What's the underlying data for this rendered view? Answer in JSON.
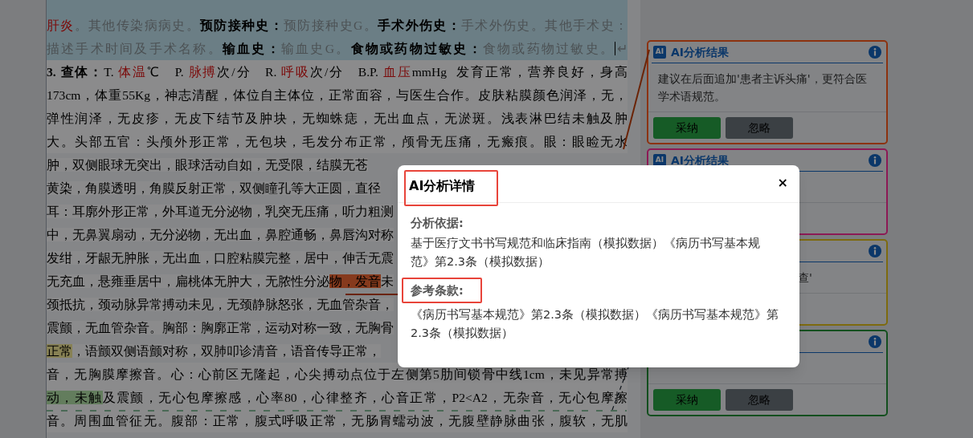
{
  "document": {
    "lines": [
      {
        "kind": "history",
        "segments": [
          {
            "text": "肝炎",
            "kind": "red"
          },
          {
            "text": "。其他传染病病史。",
            "kind": "muted"
          },
          {
            "text": "预防接种史：",
            "kind": "bold"
          },
          {
            "text": "预防接种史G。",
            "kind": "muted"
          },
          {
            "text": "手术外伤史：",
            "kind": "bold"
          },
          {
            "text": "手术外伤史。其他手术史：",
            "kind": "muted"
          }
        ]
      },
      {
        "kind": "history",
        "segments": [
          {
            "text": "描述手术时间及手术名称。",
            "kind": "muted"
          },
          {
            "text": "输血史：",
            "kind": "bold"
          },
          {
            "text": "输血史G。",
            "kind": "muted"
          },
          {
            "text": "食物或药物过敏史：",
            "kind": "bold"
          },
          {
            "text": "食物或药物过敏史。",
            "kind": "muted"
          },
          {
            "text": "↵",
            "kind": "mark"
          }
        ]
      },
      {
        "kind": "exam",
        "segments": [
          {
            "text": "3. 查体：",
            "kind": "bold"
          },
          {
            "text": "T. ",
            "kind": "plain"
          },
          {
            "text": "体温",
            "kind": "red"
          },
          {
            "text": "℃   P. ",
            "kind": "plain"
          },
          {
            "text": "脉搏",
            "kind": "red"
          },
          {
            "text": "次/分   R. ",
            "kind": "plain"
          },
          {
            "text": "呼吸",
            "kind": "red"
          },
          {
            "text": "次/分   B.P. ",
            "kind": "plain"
          },
          {
            "text": "血压",
            "kind": "red"
          },
          {
            "text": "mmHg  发育正常，营养良好，身高",
            "kind": "plain"
          }
        ]
      },
      {
        "kind": "exam",
        "segments": [
          {
            "text": "173cm，体重55Kg，神志清醒，体位自主体位，正常面容，与医生合作。皮肤粘膜颜色润泽，无，",
            "kind": "plain"
          }
        ]
      },
      {
        "kind": "exam",
        "segments": [
          {
            "text": "弹性润泽，无皮疹，无皮下结节及肿块，无蜘蛛痣，无出血点，无淤斑。浅表淋巴结未触及肿",
            "kind": "plain"
          }
        ]
      },
      {
        "kind": "exam",
        "segments": [
          {
            "text": "大。头部五官：头颅外形正常，无包块，毛发分布正常，颅骨无压痛，无瘢痕。眼：眼睑无水",
            "kind": "plain"
          }
        ]
      },
      {
        "kind": "exam",
        "segments": [
          {
            "text": "肿，双侧眼球无突出，眼球活动自如，无受限，结膜无苍",
            "kind": "plain"
          }
        ]
      },
      {
        "kind": "exam",
        "segments": [
          {
            "text": "黄染，角膜透明，角膜反射正常，双侧瞳孔等大正圆，直径",
            "kind": "plain"
          }
        ]
      },
      {
        "kind": "exam",
        "segments": [
          {
            "text": "耳：耳廓外形正常，外耳道无分泌物，乳突无压痛，听力粗测",
            "kind": "plain"
          }
        ]
      },
      {
        "kind": "exam",
        "segments": [
          {
            "text": "中，无鼻翼扇动，无分泌物，无出血，鼻腔通畅，鼻唇沟对称",
            "kind": "plain"
          }
        ]
      },
      {
        "kind": "exam",
        "segments": [
          {
            "text": "发绀，牙龈无肿胀，无出血，口腔粘膜完整，居中，伸舌无震",
            "kind": "plain"
          }
        ]
      },
      {
        "kind": "exam",
        "segments": [
          {
            "text": "无充血，悬雍垂居中，扁桃体无肿大，无脓性分泌",
            "kind": "plain"
          },
          {
            "text": "物，发音",
            "kind": "flag_orange"
          },
          {
            "text": "未",
            "kind": "plain"
          }
        ]
      },
      {
        "kind": "exam",
        "segments": [
          {
            "text": "颈抵抗，颈动脉异常搏动未见，无颈静脉怒张，无血管杂音，",
            "kind": "plain"
          }
        ]
      },
      {
        "kind": "exam",
        "segments": [
          {
            "text": "震颤，无血管杂音。胸部：胸廓正常，运动对称一致，无胸骨",
            "kind": "plain"
          }
        ]
      },
      {
        "kind": "exam",
        "segments": [
          {
            "text": "正常",
            "kind": "flag_yellow"
          },
          {
            "text": "，语颤双侧语颤对称，双肺叩诊清音，语音传导正常，",
            "kind": "plain"
          }
        ]
      },
      {
        "kind": "exam",
        "segments": [
          {
            "text": "音，无胸膜摩擦音。心：心前区无隆起，心尖搏动点位于左侧第5肋间锁骨中线1cm，未见异常搏",
            "kind": "plain"
          }
        ]
      },
      {
        "kind": "exam",
        "segments": [
          {
            "text": "动，未触",
            "kind": "flag_green"
          },
          {
            "text": "及震颤，无心包摩擦感，心率80，心律整齐，心音正常，P2<A2，无杂音，无心包摩擦",
            "kind": "plain"
          }
        ]
      },
      {
        "kind": "exam",
        "segments": [
          {
            "text": "音。周围血管征无。腹部：正常，腹式呼吸正常，无肠胃蠕动波，无腹壁静脉曲张，腹软，无肌",
            "kind": "plain"
          }
        ]
      }
    ]
  },
  "cards": [
    {
      "color": "#8f3210",
      "badge": "AI",
      "title": "AI分析结果",
      "body": "建议在后面追加'患者主诉头痛'，更符合医学术语规范。",
      "buttons": [
        {
          "label": "采纳",
          "kind": "accept"
        },
        {
          "label": "忽略",
          "kind": "ignore"
        }
      ]
    },
    {
      "color": "#8c1a55",
      "badge": "AI",
      "title": "AI分析结果"
    },
    {
      "color": "#7d6a10",
      "body": "查'",
      "body_cut": true
    },
    {
      "color": "#14501e",
      "buttons": [
        {
          "label": "采纳",
          "kind": "accept"
        },
        {
          "label": "忽略",
          "kind": "ignore"
        }
      ]
    }
  ],
  "modal": {
    "title": "AI分析详情",
    "close": "×",
    "sections": [
      {
        "heading": "分析依据:",
        "text": "基于医疗文书书写规范和临床指南（模拟数据）《病历书写基本规范》第2.3条（模拟数据）",
        "annotated": false
      },
      {
        "heading": "参考条款:",
        "text": "《病历书写基本规范》第2.3条（模拟数据）《病历书写基本规范》第2.3条（模拟数据）",
        "annotated": true
      }
    ]
  }
}
